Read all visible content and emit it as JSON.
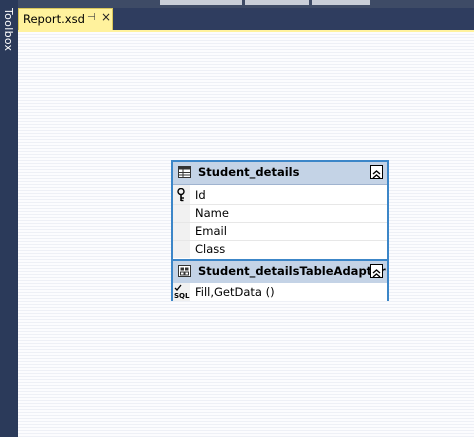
{
  "toolbox": {
    "label": "Toolbox"
  },
  "tab": {
    "label": "Report.xsd",
    "pin_glyph": "⊣",
    "close_glyph": "×"
  },
  "datatable": {
    "title": "Student_details",
    "columns": [
      {
        "name": "Id",
        "is_key": true
      },
      {
        "name": "Name",
        "is_key": false
      },
      {
        "name": "Email",
        "is_key": false
      },
      {
        "name": "Class",
        "is_key": false
      }
    ]
  },
  "adapter": {
    "title": "Student_detailsTableAdapter",
    "query_icon": "SQL",
    "query": "Fill,GetData ()"
  },
  "colors": {
    "accent_border": "#3c86c8",
    "header_bg": "#c4d3e6",
    "tab_bg": "#fff29d",
    "dark_chrome": "#2b3a5a"
  }
}
